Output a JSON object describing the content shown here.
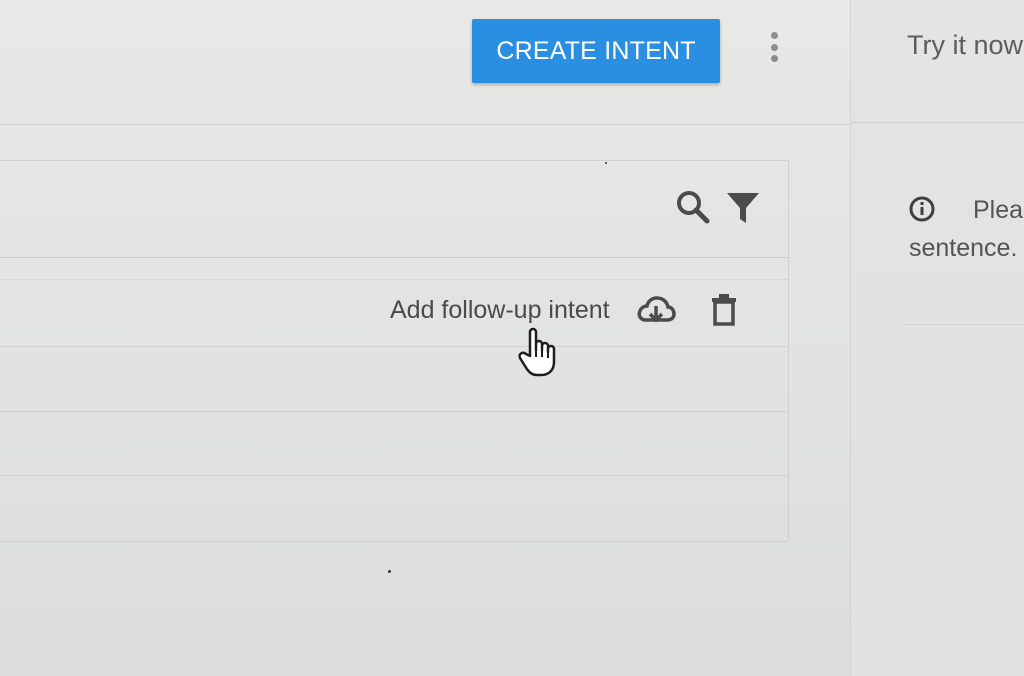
{
  "toolbar": {
    "create_intent_label": "CREATE INTENT",
    "more_menu_icon": "more-vert-icon"
  },
  "list": {
    "header_icons": [
      "search-icon",
      "filter-icon"
    ],
    "row": {
      "add_followup_label": "Add follow-up intent",
      "icons": [
        "cloud-download-icon",
        "trash-icon"
      ]
    }
  },
  "right_panel": {
    "title": "Try it now",
    "info_icon": "info-icon",
    "info_text_line1": "Plea",
    "info_text_line2": "sentence."
  },
  "colors": {
    "accent": "#2a8fe0",
    "background": "#e6e6e4",
    "icon": "#4b4c4a",
    "text": "#4a4b49"
  }
}
